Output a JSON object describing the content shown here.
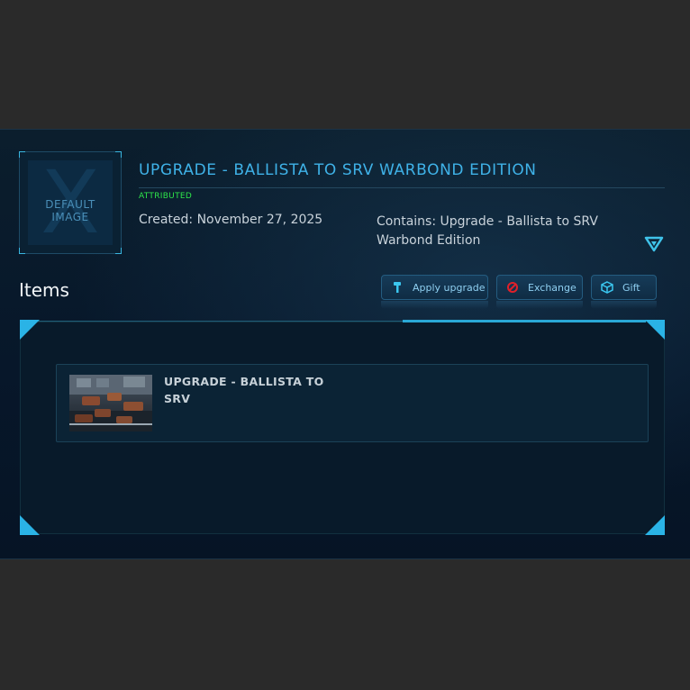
{
  "package": {
    "image_label_line1": "DEFAULT",
    "image_label_line2": "IMAGE",
    "title": "UPGRADE - BALLISTA TO SRV WARBOND EDITION",
    "status": "ATTRIBUTED",
    "created": "Created: November 27, 2025",
    "contains": "Contains: Upgrade - Ballista to SRV Warbond Edition"
  },
  "items_section": {
    "heading": "Items"
  },
  "actions": {
    "apply_upgrade": "Apply upgrade",
    "exchange": "Exchange",
    "gift": "Gift"
  },
  "items": [
    {
      "title": "UPGRADE - BALLISTA TO SRV"
    }
  ],
  "colors": {
    "accent": "#3fb2e8",
    "status": "#2ee64a",
    "exchange_icon": "#e0202a"
  },
  "icons": {
    "apply": "hammer-icon",
    "exchange": "no-entry-icon",
    "gift": "gift-cube-icon",
    "expand": "chevron-down-icon"
  }
}
